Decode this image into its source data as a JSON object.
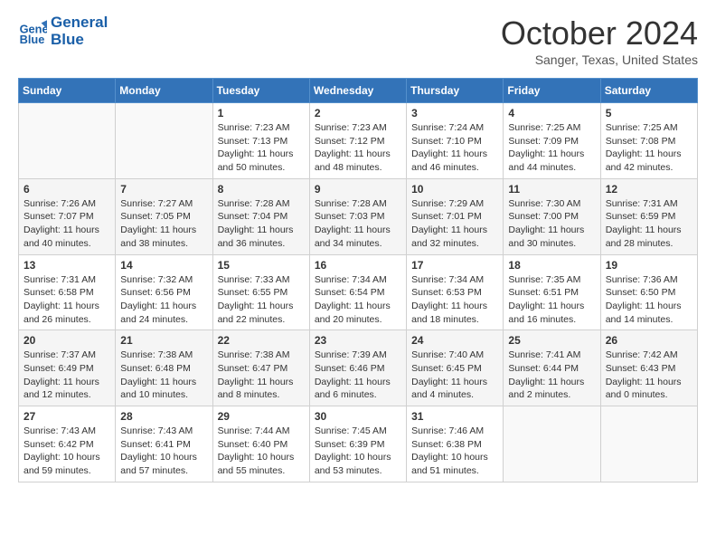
{
  "header": {
    "logo_line1": "General",
    "logo_line2": "Blue",
    "month": "October 2024",
    "location": "Sanger, Texas, United States"
  },
  "weekdays": [
    "Sunday",
    "Monday",
    "Tuesday",
    "Wednesday",
    "Thursday",
    "Friday",
    "Saturday"
  ],
  "weeks": [
    [
      {
        "day": "",
        "sunrise": "",
        "sunset": "",
        "daylight": ""
      },
      {
        "day": "",
        "sunrise": "",
        "sunset": "",
        "daylight": ""
      },
      {
        "day": "1",
        "sunrise": "Sunrise: 7:23 AM",
        "sunset": "Sunset: 7:13 PM",
        "daylight": "Daylight: 11 hours and 50 minutes."
      },
      {
        "day": "2",
        "sunrise": "Sunrise: 7:23 AM",
        "sunset": "Sunset: 7:12 PM",
        "daylight": "Daylight: 11 hours and 48 minutes."
      },
      {
        "day": "3",
        "sunrise": "Sunrise: 7:24 AM",
        "sunset": "Sunset: 7:10 PM",
        "daylight": "Daylight: 11 hours and 46 minutes."
      },
      {
        "day": "4",
        "sunrise": "Sunrise: 7:25 AM",
        "sunset": "Sunset: 7:09 PM",
        "daylight": "Daylight: 11 hours and 44 minutes."
      },
      {
        "day": "5",
        "sunrise": "Sunrise: 7:25 AM",
        "sunset": "Sunset: 7:08 PM",
        "daylight": "Daylight: 11 hours and 42 minutes."
      }
    ],
    [
      {
        "day": "6",
        "sunrise": "Sunrise: 7:26 AM",
        "sunset": "Sunset: 7:07 PM",
        "daylight": "Daylight: 11 hours and 40 minutes."
      },
      {
        "day": "7",
        "sunrise": "Sunrise: 7:27 AM",
        "sunset": "Sunset: 7:05 PM",
        "daylight": "Daylight: 11 hours and 38 minutes."
      },
      {
        "day": "8",
        "sunrise": "Sunrise: 7:28 AM",
        "sunset": "Sunset: 7:04 PM",
        "daylight": "Daylight: 11 hours and 36 minutes."
      },
      {
        "day": "9",
        "sunrise": "Sunrise: 7:28 AM",
        "sunset": "Sunset: 7:03 PM",
        "daylight": "Daylight: 11 hours and 34 minutes."
      },
      {
        "day": "10",
        "sunrise": "Sunrise: 7:29 AM",
        "sunset": "Sunset: 7:01 PM",
        "daylight": "Daylight: 11 hours and 32 minutes."
      },
      {
        "day": "11",
        "sunrise": "Sunrise: 7:30 AM",
        "sunset": "Sunset: 7:00 PM",
        "daylight": "Daylight: 11 hours and 30 minutes."
      },
      {
        "day": "12",
        "sunrise": "Sunrise: 7:31 AM",
        "sunset": "Sunset: 6:59 PM",
        "daylight": "Daylight: 11 hours and 28 minutes."
      }
    ],
    [
      {
        "day": "13",
        "sunrise": "Sunrise: 7:31 AM",
        "sunset": "Sunset: 6:58 PM",
        "daylight": "Daylight: 11 hours and 26 minutes."
      },
      {
        "day": "14",
        "sunrise": "Sunrise: 7:32 AM",
        "sunset": "Sunset: 6:56 PM",
        "daylight": "Daylight: 11 hours and 24 minutes."
      },
      {
        "day": "15",
        "sunrise": "Sunrise: 7:33 AM",
        "sunset": "Sunset: 6:55 PM",
        "daylight": "Daylight: 11 hours and 22 minutes."
      },
      {
        "day": "16",
        "sunrise": "Sunrise: 7:34 AM",
        "sunset": "Sunset: 6:54 PM",
        "daylight": "Daylight: 11 hours and 20 minutes."
      },
      {
        "day": "17",
        "sunrise": "Sunrise: 7:34 AM",
        "sunset": "Sunset: 6:53 PM",
        "daylight": "Daylight: 11 hours and 18 minutes."
      },
      {
        "day": "18",
        "sunrise": "Sunrise: 7:35 AM",
        "sunset": "Sunset: 6:51 PM",
        "daylight": "Daylight: 11 hours and 16 minutes."
      },
      {
        "day": "19",
        "sunrise": "Sunrise: 7:36 AM",
        "sunset": "Sunset: 6:50 PM",
        "daylight": "Daylight: 11 hours and 14 minutes."
      }
    ],
    [
      {
        "day": "20",
        "sunrise": "Sunrise: 7:37 AM",
        "sunset": "Sunset: 6:49 PM",
        "daylight": "Daylight: 11 hours and 12 minutes."
      },
      {
        "day": "21",
        "sunrise": "Sunrise: 7:38 AM",
        "sunset": "Sunset: 6:48 PM",
        "daylight": "Daylight: 11 hours and 10 minutes."
      },
      {
        "day": "22",
        "sunrise": "Sunrise: 7:38 AM",
        "sunset": "Sunset: 6:47 PM",
        "daylight": "Daylight: 11 hours and 8 minutes."
      },
      {
        "day": "23",
        "sunrise": "Sunrise: 7:39 AM",
        "sunset": "Sunset: 6:46 PM",
        "daylight": "Daylight: 11 hours and 6 minutes."
      },
      {
        "day": "24",
        "sunrise": "Sunrise: 7:40 AM",
        "sunset": "Sunset: 6:45 PM",
        "daylight": "Daylight: 11 hours and 4 minutes."
      },
      {
        "day": "25",
        "sunrise": "Sunrise: 7:41 AM",
        "sunset": "Sunset: 6:44 PM",
        "daylight": "Daylight: 11 hours and 2 minutes."
      },
      {
        "day": "26",
        "sunrise": "Sunrise: 7:42 AM",
        "sunset": "Sunset: 6:43 PM",
        "daylight": "Daylight: 11 hours and 0 minutes."
      }
    ],
    [
      {
        "day": "27",
        "sunrise": "Sunrise: 7:43 AM",
        "sunset": "Sunset: 6:42 PM",
        "daylight": "Daylight: 10 hours and 59 minutes."
      },
      {
        "day": "28",
        "sunrise": "Sunrise: 7:43 AM",
        "sunset": "Sunset: 6:41 PM",
        "daylight": "Daylight: 10 hours and 57 minutes."
      },
      {
        "day": "29",
        "sunrise": "Sunrise: 7:44 AM",
        "sunset": "Sunset: 6:40 PM",
        "daylight": "Daylight: 10 hours and 55 minutes."
      },
      {
        "day": "30",
        "sunrise": "Sunrise: 7:45 AM",
        "sunset": "Sunset: 6:39 PM",
        "daylight": "Daylight: 10 hours and 53 minutes."
      },
      {
        "day": "31",
        "sunrise": "Sunrise: 7:46 AM",
        "sunset": "Sunset: 6:38 PM",
        "daylight": "Daylight: 10 hours and 51 minutes."
      },
      {
        "day": "",
        "sunrise": "",
        "sunset": "",
        "daylight": ""
      },
      {
        "day": "",
        "sunrise": "",
        "sunset": "",
        "daylight": ""
      }
    ]
  ]
}
